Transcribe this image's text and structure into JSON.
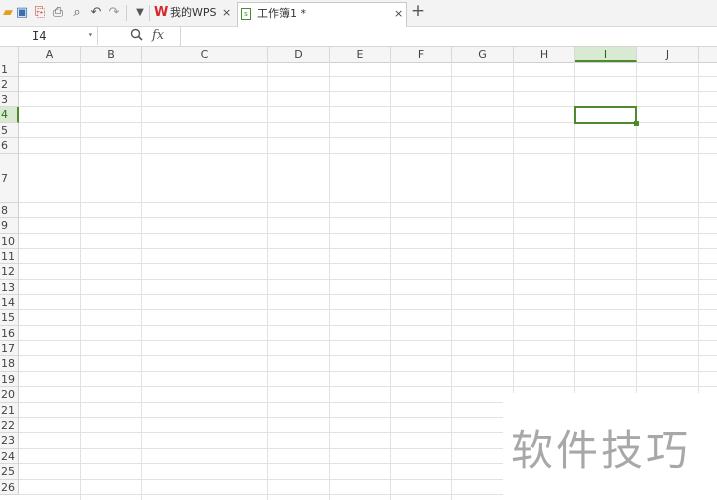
{
  "toolbar": {
    "icons": [
      "open-folder-icon",
      "save-icon",
      "export-pdf-icon",
      "print-icon",
      "print-preview-icon",
      "undo-icon",
      "redo-icon",
      "more-dropdown-icon"
    ]
  },
  "tabs": [
    {
      "label": "我的WPS",
      "close": "×"
    },
    {
      "label": "工作簿1 *",
      "close": "×"
    }
  ],
  "new_tab": "+",
  "formula_bar": {
    "name_box": "I4",
    "dropdown": "▾",
    "zoom_icon": "🔍",
    "fx": "fx",
    "content": ""
  },
  "columns": [
    "A",
    "B",
    "C",
    "D",
    "E",
    "F",
    "G",
    "H",
    "I",
    "J"
  ],
  "rows": [
    "1",
    "2",
    "3",
    "4",
    "5",
    "6",
    "7",
    "8",
    "9",
    "10",
    "11",
    "12",
    "13",
    "14",
    "15",
    "16",
    "17",
    "18",
    "19",
    "20",
    "21",
    "22",
    "23",
    "24",
    "25",
    "26"
  ],
  "selected_cell": {
    "ref": "I4",
    "column": "I",
    "row": "4"
  },
  "watermark": "软件技巧",
  "colors": {
    "accent": "#4e8a2f",
    "wps_red": "#d6262b",
    "header_bg": "#f5f5f5",
    "selected_header_bg": "#d9ead3"
  }
}
